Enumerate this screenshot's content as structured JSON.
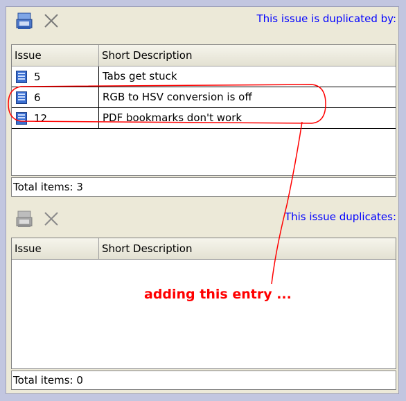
{
  "top_panel": {
    "caption": "This issue is duplicated by:",
    "columns": [
      "Issue",
      "Short Description"
    ],
    "rows": [
      {
        "issue": "5",
        "description": "Tabs get stuck"
      },
      {
        "issue": "6",
        "description": "RGB to HSV conversion is off"
      },
      {
        "issue": "12",
        "description": "PDF bookmarks don't work"
      }
    ],
    "total": "Total items: 3"
  },
  "bottom_panel": {
    "caption": "This issue duplicates:",
    "columns": [
      "Issue",
      "Short Description"
    ],
    "total": "Total items: 0"
  },
  "annotation": "adding this entry ...",
  "icons": [
    "save-icon",
    "delete-icon",
    "issue-icon"
  ],
  "colors": {
    "caption": "#0000ff",
    "annotation": "#ff0000",
    "icon_blue": "#3b6fd0"
  }
}
